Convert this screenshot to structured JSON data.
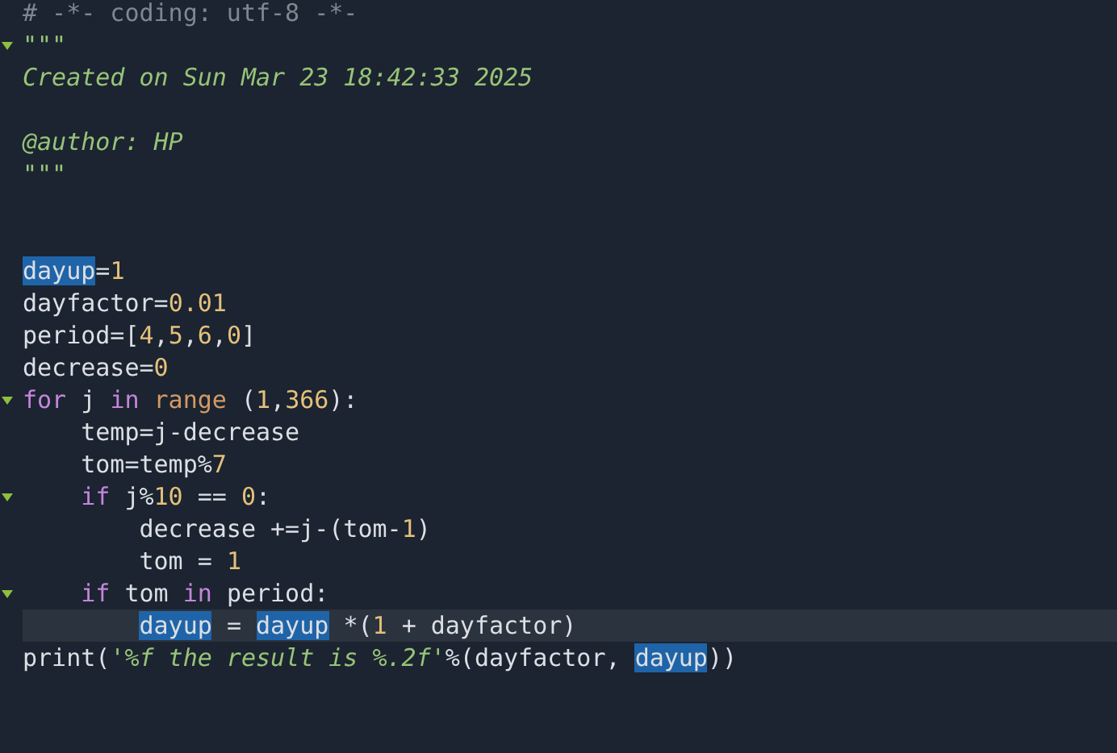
{
  "editor": {
    "lines": [
      {
        "fold": false,
        "current": false,
        "tokens": [
          {
            "kind": "comment",
            "text": "# -*- coding: utf-8 -*-"
          }
        ]
      },
      {
        "fold": true,
        "current": false,
        "tokens": [
          {
            "kind": "string",
            "text": "\"\"\""
          }
        ]
      },
      {
        "fold": false,
        "current": false,
        "tokens": [
          {
            "kind": "string",
            "text": "Created on Sun Mar 23 18:42:33 2025"
          }
        ]
      },
      {
        "fold": false,
        "current": false
      },
      {
        "fold": false,
        "current": false,
        "tokens": [
          {
            "kind": "string",
            "text": "@author: HP"
          }
        ]
      },
      {
        "fold": false,
        "current": false,
        "tokens": [
          {
            "kind": "string",
            "text": "\"\"\""
          }
        ]
      },
      {
        "fold": false,
        "current": false
      },
      {
        "fold": false,
        "current": false
      },
      {
        "fold": false,
        "current": false,
        "tokens": [
          {
            "kind": "occurrence",
            "text": "dayup"
          },
          {
            "kind": "plain",
            "text": "="
          },
          {
            "kind": "number",
            "text": "1"
          }
        ]
      },
      {
        "fold": false,
        "current": false,
        "tokens": [
          {
            "kind": "plain",
            "text": "dayfactor="
          },
          {
            "kind": "number",
            "text": "0.01"
          }
        ]
      },
      {
        "fold": false,
        "current": false,
        "tokens": [
          {
            "kind": "plain",
            "text": "period=["
          },
          {
            "kind": "number",
            "text": "4"
          },
          {
            "kind": "plain",
            "text": ","
          },
          {
            "kind": "number",
            "text": "5"
          },
          {
            "kind": "plain",
            "text": ","
          },
          {
            "kind": "number",
            "text": "6"
          },
          {
            "kind": "plain",
            "text": ","
          },
          {
            "kind": "number",
            "text": "0"
          },
          {
            "kind": "plain",
            "text": "]"
          }
        ]
      },
      {
        "fold": false,
        "current": false,
        "tokens": [
          {
            "kind": "plain",
            "text": "decrease="
          },
          {
            "kind": "number",
            "text": "0"
          }
        ]
      },
      {
        "fold": true,
        "current": false,
        "tokens": [
          {
            "kind": "keyword",
            "text": "for"
          },
          {
            "kind": "plain",
            "text": " j "
          },
          {
            "kind": "keyword",
            "text": "in"
          },
          {
            "kind": "builtin",
            "text": " range"
          },
          {
            "kind": "plain",
            "text": " ("
          },
          {
            "kind": "number",
            "text": "1"
          },
          {
            "kind": "plain",
            "text": ","
          },
          {
            "kind": "number",
            "text": "366"
          },
          {
            "kind": "plain",
            "text": "):"
          }
        ]
      },
      {
        "fold": false,
        "current": false,
        "tokens": [
          {
            "kind": "plain",
            "text": "    temp=j-decrease"
          }
        ]
      },
      {
        "fold": false,
        "current": false,
        "tokens": [
          {
            "kind": "plain",
            "text": "    tom=temp%"
          },
          {
            "kind": "number",
            "text": "7"
          }
        ]
      },
      {
        "fold": true,
        "current": false,
        "tokens": [
          {
            "kind": "keyword",
            "text": "    if"
          },
          {
            "kind": "plain",
            "text": " j%"
          },
          {
            "kind": "number",
            "text": "10"
          },
          {
            "kind": "plain",
            "text": " == "
          },
          {
            "kind": "number",
            "text": "0"
          },
          {
            "kind": "plain",
            "text": ":"
          }
        ]
      },
      {
        "fold": false,
        "current": false,
        "tokens": [
          {
            "kind": "plain",
            "text": "        decrease +=j-(tom-"
          },
          {
            "kind": "number",
            "text": "1"
          },
          {
            "kind": "plain",
            "text": ")"
          }
        ]
      },
      {
        "fold": false,
        "current": false,
        "tokens": [
          {
            "kind": "plain",
            "text": "        tom = "
          },
          {
            "kind": "number",
            "text": "1"
          }
        ]
      },
      {
        "fold": true,
        "current": false,
        "tokens": [
          {
            "kind": "keyword",
            "text": "    if"
          },
          {
            "kind": "plain",
            "text": " tom "
          },
          {
            "kind": "keyword",
            "text": "in"
          },
          {
            "kind": "plain",
            "text": " period:"
          }
        ]
      },
      {
        "fold": false,
        "current": true,
        "tokens": [
          {
            "kind": "occurrence",
            "text": "        dayup"
          },
          {
            "kind": "plain",
            "text": " = "
          },
          {
            "kind": "occurrence",
            "text": "dayup"
          },
          {
            "kind": "plain",
            "text": " *("
          },
          {
            "kind": "number",
            "text": "1"
          },
          {
            "kind": "plain",
            "text": " + dayfactor)"
          }
        ]
      },
      {
        "fold": false,
        "current": false,
        "tokens": [
          {
            "kind": "plain",
            "text": "print("
          },
          {
            "kind": "string",
            "text": "'%f the result is %.2f'"
          },
          {
            "kind": "plain",
            "text": "%(dayfactor, "
          },
          {
            "kind": "occurrence",
            "text": "dayup"
          },
          {
            "kind": "plain",
            "text": "))"
          }
        ]
      }
    ]
  }
}
